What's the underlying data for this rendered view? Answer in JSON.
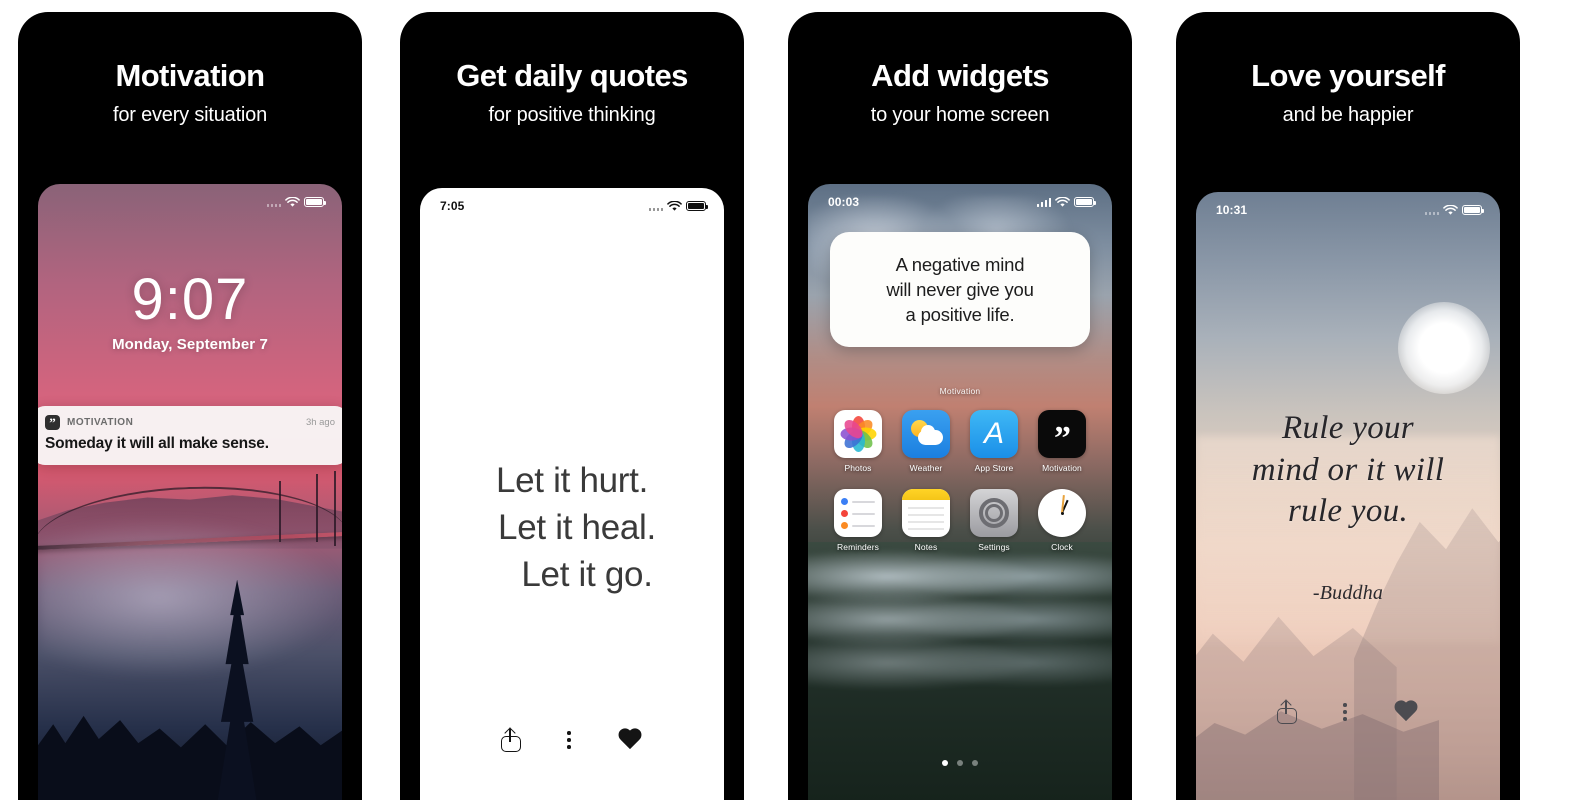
{
  "gallery": {
    "panels": [
      {
        "caption": {
          "title": "Motivation",
          "subtitle": "for every situation"
        },
        "status": {
          "time": ""
        },
        "lockscreen": {
          "time": "9:07",
          "date": "Monday, September 7",
          "notification": {
            "app": "MOTIVATION",
            "icon": "quote-mark-icon",
            "timestamp": "3h ago",
            "message": "Someday it will all make sense."
          }
        }
      },
      {
        "caption": {
          "title": "Get daily quotes",
          "subtitle": "for positive thinking"
        },
        "status": {
          "time": "7:05"
        },
        "quote": {
          "line1": "Let it hurt.",
          "line2": "Let it heal.",
          "line3": "Let it go."
        },
        "actions": [
          {
            "name": "share-icon",
            "label": "Share"
          },
          {
            "name": "more-options-icon",
            "label": "More"
          },
          {
            "name": "favorite-heart-icon",
            "label": "Favorite"
          }
        ]
      },
      {
        "caption": {
          "title": "Add widgets",
          "subtitle": "to your home screen"
        },
        "status": {
          "time": "00:03"
        },
        "widget": {
          "line1": "A negative mind",
          "line2": "will never give you",
          "line3": "a positive life.",
          "label": "Motivation"
        },
        "apps": [
          {
            "name": "Photos",
            "icon": "photos-icon"
          },
          {
            "name": "Weather",
            "icon": "weather-icon"
          },
          {
            "name": "App Store",
            "icon": "app-store-icon"
          },
          {
            "name": "Motivation",
            "icon": "motivation-icon",
            "glyph": "”"
          },
          {
            "name": "Reminders",
            "icon": "reminders-icon"
          },
          {
            "name": "Notes",
            "icon": "notes-icon"
          },
          {
            "name": "Settings",
            "icon": "settings-icon"
          },
          {
            "name": "Clock",
            "icon": "clock-icon"
          }
        ],
        "page_dots": {
          "count": 3,
          "active_index": 0
        }
      },
      {
        "caption": {
          "title": "Love yourself",
          "subtitle": "and be happier"
        },
        "status": {
          "time": "10:31"
        },
        "quote": {
          "line1": "Rule your",
          "line2": "mind or it will",
          "line3": "rule you.",
          "author": "-Buddha"
        },
        "actions": [
          {
            "name": "share-icon",
            "label": "Share"
          },
          {
            "name": "more-options-icon",
            "label": "More"
          },
          {
            "name": "favorite-heart-icon",
            "label": "Favorite"
          }
        ]
      }
    ]
  },
  "colors": {
    "panel_background": "#000000",
    "caption_text": "#ffffff",
    "widget_card": "#fdfdfb",
    "accent_icon_dark": "#141414"
  }
}
